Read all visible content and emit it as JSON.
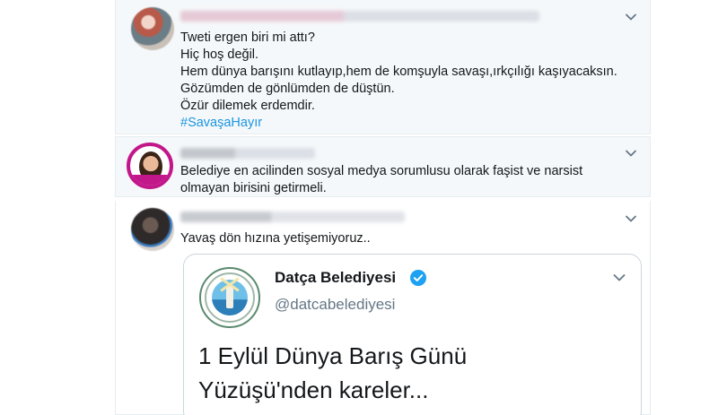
{
  "tweets": [
    {
      "lines": [
        "Tweti ergen biri mi attı?",
        "Hiç hoş değil.",
        "Hem dünya barışını kutlayıp,hem de komşuyla savaşı,ırkçılığı kaşıyacaksın.",
        "Gözümden de gönlümden de düştün.",
        "Özür dilemek erdemdir."
      ],
      "hashtag": "#SavaşaHayır"
    },
    {
      "lines": [
        "Belediye en acilinden sosyal medya sorumlusu olarak faşist ve narsist",
        "olmayan birisini getirmeli."
      ]
    },
    {
      "lines": [
        "Yavaş dön hızına yetişemiyoruz.."
      ],
      "quoted": {
        "name": "Datça Belediyesi",
        "handle": "@datcabelediyesi",
        "body_lines": [
          "1 Eylül Dünya Barış Günü",
          "Yüzüşü'nden kareler..."
        ]
      }
    }
  ],
  "icons": {
    "chevron": "chevron-down-icon",
    "verified": "verified-badge-icon"
  },
  "colors": {
    "hashtag": "#1b95e0",
    "verified": "#1da1f2",
    "border": "#e6ecf0",
    "muted": "#657786"
  }
}
